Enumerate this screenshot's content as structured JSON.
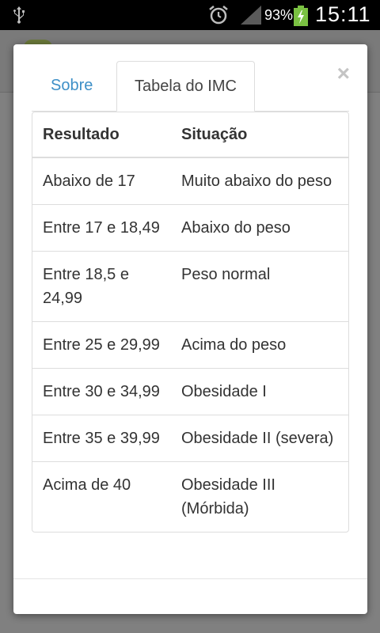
{
  "status_bar": {
    "battery_percent": "93%",
    "time": "15:11",
    "icons": [
      "usb-icon",
      "alarm-icon",
      "signal-icon",
      "battery-charging-icon"
    ]
  },
  "modal": {
    "close_label": "×",
    "tabs": [
      {
        "label": "Sobre",
        "active": false
      },
      {
        "label": "Tabela do IMC",
        "active": true
      }
    ],
    "table": {
      "headers": [
        "Resultado",
        "Situação"
      ],
      "rows": [
        [
          "Abaixo de 17",
          "Muito abaixo do peso"
        ],
        [
          "Entre 17 e 18,49",
          "Abaixo do peso"
        ],
        [
          "Entre 18,5 e 24,99",
          "Peso normal"
        ],
        [
          "Entre 25 e 29,99",
          "Acima do peso"
        ],
        [
          "Entre 30 e 34,99",
          "Obesidade I"
        ],
        [
          "Entre 35 e 39,99",
          "Obesidade II (severa)"
        ],
        [
          "Acima de 40",
          "Obesidade III (Mórbida)"
        ]
      ]
    }
  },
  "colors": {
    "tab_link": "#3d8fc7",
    "statusbar_bg": "#000000",
    "battery_green": "#7ac142"
  }
}
